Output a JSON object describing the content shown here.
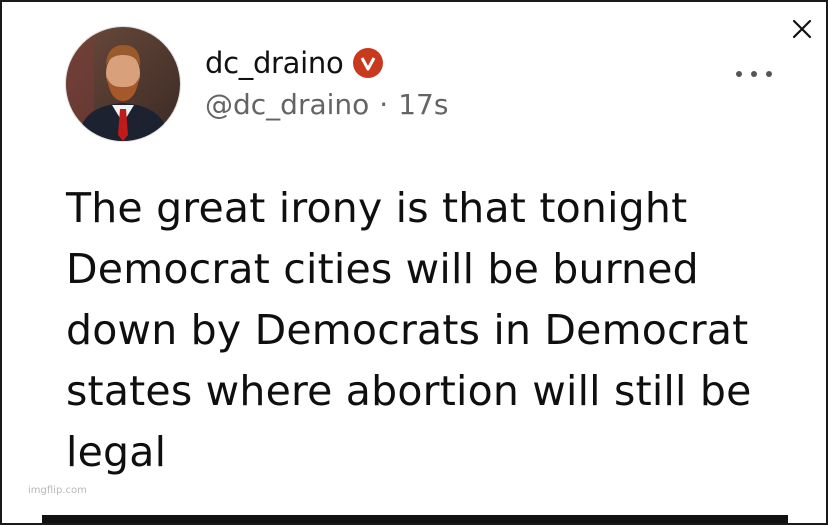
{
  "post": {
    "display_name": "dc_draino",
    "handle": "@dc_draino",
    "separator": "·",
    "time_ago": "17s",
    "text": "The great irony is that tonight Democrat cities will be burned down by Democrats in Democrat states where abortion will still be legal",
    "verified_badge_letter": "V"
  },
  "watermark": "imgflip.com",
  "icons": {
    "close": "close-icon",
    "more": "more-options-icon",
    "verified": "verified-badge-icon"
  },
  "colors": {
    "verified_badge": "#c8391d",
    "text_primary": "#0f0f0f",
    "text_secondary": "#646464"
  }
}
